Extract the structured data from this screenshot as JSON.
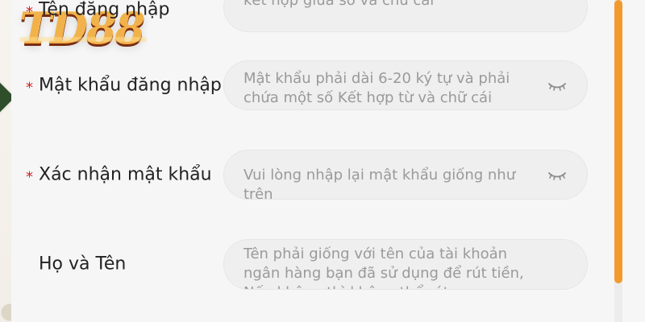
{
  "brand": {
    "logo_text": "TD88"
  },
  "colors": {
    "accent": "#f39a2e",
    "required": "#d62020",
    "field_bg": "#efefef",
    "panel_bg": "#f6f6f6"
  },
  "form": {
    "rows": [
      {
        "label": "Tên đăng nhập",
        "required": true,
        "placeholder": "kết hợp giữa số và chữ cái",
        "has_eye_icon": false
      },
      {
        "label": "Mật khẩu đăng nhập",
        "required": true,
        "placeholder": "Mật khẩu phải dài 6-20 ký tự và phải chứa một số Kết hợp từ và chữ cái",
        "has_eye_icon": true,
        "icon_name": "eye-closed-icon"
      },
      {
        "label": "Xác nhận mật khẩu",
        "required": true,
        "placeholder": "Vui lòng nhập lại mật khẩu giống như trên",
        "has_eye_icon": true,
        "icon_name": "eye-closed-icon"
      },
      {
        "label": "Họ và Tên",
        "required": false,
        "placeholder": "Tên phải giống với tên của tài khoản ngân hàng bạn đã sử dụng để rút tiền, Nếu không thì không thể rút",
        "has_eye_icon": false
      }
    ]
  }
}
